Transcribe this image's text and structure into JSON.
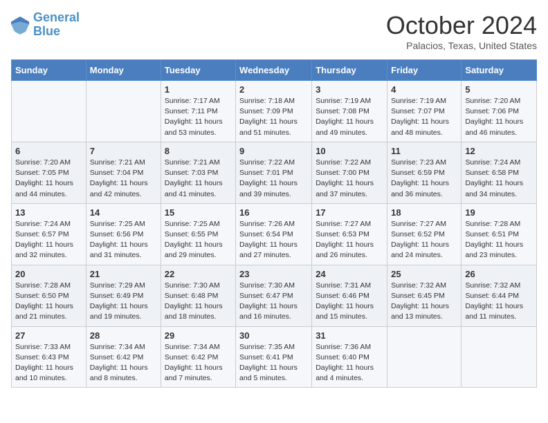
{
  "logo": {
    "line1": "General",
    "line2": "Blue"
  },
  "title": "October 2024",
  "subtitle": "Palacios, Texas, United States",
  "days_of_week": [
    "Sunday",
    "Monday",
    "Tuesday",
    "Wednesday",
    "Thursday",
    "Friday",
    "Saturday"
  ],
  "weeks": [
    [
      {
        "day": "",
        "info": ""
      },
      {
        "day": "",
        "info": ""
      },
      {
        "day": "1",
        "info": "Sunrise: 7:17 AM\nSunset: 7:11 PM\nDaylight: 11 hours and 53 minutes."
      },
      {
        "day": "2",
        "info": "Sunrise: 7:18 AM\nSunset: 7:09 PM\nDaylight: 11 hours and 51 minutes."
      },
      {
        "day": "3",
        "info": "Sunrise: 7:19 AM\nSunset: 7:08 PM\nDaylight: 11 hours and 49 minutes."
      },
      {
        "day": "4",
        "info": "Sunrise: 7:19 AM\nSunset: 7:07 PM\nDaylight: 11 hours and 48 minutes."
      },
      {
        "day": "5",
        "info": "Sunrise: 7:20 AM\nSunset: 7:06 PM\nDaylight: 11 hours and 46 minutes."
      }
    ],
    [
      {
        "day": "6",
        "info": "Sunrise: 7:20 AM\nSunset: 7:05 PM\nDaylight: 11 hours and 44 minutes."
      },
      {
        "day": "7",
        "info": "Sunrise: 7:21 AM\nSunset: 7:04 PM\nDaylight: 11 hours and 42 minutes."
      },
      {
        "day": "8",
        "info": "Sunrise: 7:21 AM\nSunset: 7:03 PM\nDaylight: 11 hours and 41 minutes."
      },
      {
        "day": "9",
        "info": "Sunrise: 7:22 AM\nSunset: 7:01 PM\nDaylight: 11 hours and 39 minutes."
      },
      {
        "day": "10",
        "info": "Sunrise: 7:22 AM\nSunset: 7:00 PM\nDaylight: 11 hours and 37 minutes."
      },
      {
        "day": "11",
        "info": "Sunrise: 7:23 AM\nSunset: 6:59 PM\nDaylight: 11 hours and 36 minutes."
      },
      {
        "day": "12",
        "info": "Sunrise: 7:24 AM\nSunset: 6:58 PM\nDaylight: 11 hours and 34 minutes."
      }
    ],
    [
      {
        "day": "13",
        "info": "Sunrise: 7:24 AM\nSunset: 6:57 PM\nDaylight: 11 hours and 32 minutes."
      },
      {
        "day": "14",
        "info": "Sunrise: 7:25 AM\nSunset: 6:56 PM\nDaylight: 11 hours and 31 minutes."
      },
      {
        "day": "15",
        "info": "Sunrise: 7:25 AM\nSunset: 6:55 PM\nDaylight: 11 hours and 29 minutes."
      },
      {
        "day": "16",
        "info": "Sunrise: 7:26 AM\nSunset: 6:54 PM\nDaylight: 11 hours and 27 minutes."
      },
      {
        "day": "17",
        "info": "Sunrise: 7:27 AM\nSunset: 6:53 PM\nDaylight: 11 hours and 26 minutes."
      },
      {
        "day": "18",
        "info": "Sunrise: 7:27 AM\nSunset: 6:52 PM\nDaylight: 11 hours and 24 minutes."
      },
      {
        "day": "19",
        "info": "Sunrise: 7:28 AM\nSunset: 6:51 PM\nDaylight: 11 hours and 23 minutes."
      }
    ],
    [
      {
        "day": "20",
        "info": "Sunrise: 7:28 AM\nSunset: 6:50 PM\nDaylight: 11 hours and 21 minutes."
      },
      {
        "day": "21",
        "info": "Sunrise: 7:29 AM\nSunset: 6:49 PM\nDaylight: 11 hours and 19 minutes."
      },
      {
        "day": "22",
        "info": "Sunrise: 7:30 AM\nSunset: 6:48 PM\nDaylight: 11 hours and 18 minutes."
      },
      {
        "day": "23",
        "info": "Sunrise: 7:30 AM\nSunset: 6:47 PM\nDaylight: 11 hours and 16 minutes."
      },
      {
        "day": "24",
        "info": "Sunrise: 7:31 AM\nSunset: 6:46 PM\nDaylight: 11 hours and 15 minutes."
      },
      {
        "day": "25",
        "info": "Sunrise: 7:32 AM\nSunset: 6:45 PM\nDaylight: 11 hours and 13 minutes."
      },
      {
        "day": "26",
        "info": "Sunrise: 7:32 AM\nSunset: 6:44 PM\nDaylight: 11 hours and 11 minutes."
      }
    ],
    [
      {
        "day": "27",
        "info": "Sunrise: 7:33 AM\nSunset: 6:43 PM\nDaylight: 11 hours and 10 minutes."
      },
      {
        "day": "28",
        "info": "Sunrise: 7:34 AM\nSunset: 6:42 PM\nDaylight: 11 hours and 8 minutes."
      },
      {
        "day": "29",
        "info": "Sunrise: 7:34 AM\nSunset: 6:42 PM\nDaylight: 11 hours and 7 minutes."
      },
      {
        "day": "30",
        "info": "Sunrise: 7:35 AM\nSunset: 6:41 PM\nDaylight: 11 hours and 5 minutes."
      },
      {
        "day": "31",
        "info": "Sunrise: 7:36 AM\nSunset: 6:40 PM\nDaylight: 11 hours and 4 minutes."
      },
      {
        "day": "",
        "info": ""
      },
      {
        "day": "",
        "info": ""
      }
    ]
  ]
}
